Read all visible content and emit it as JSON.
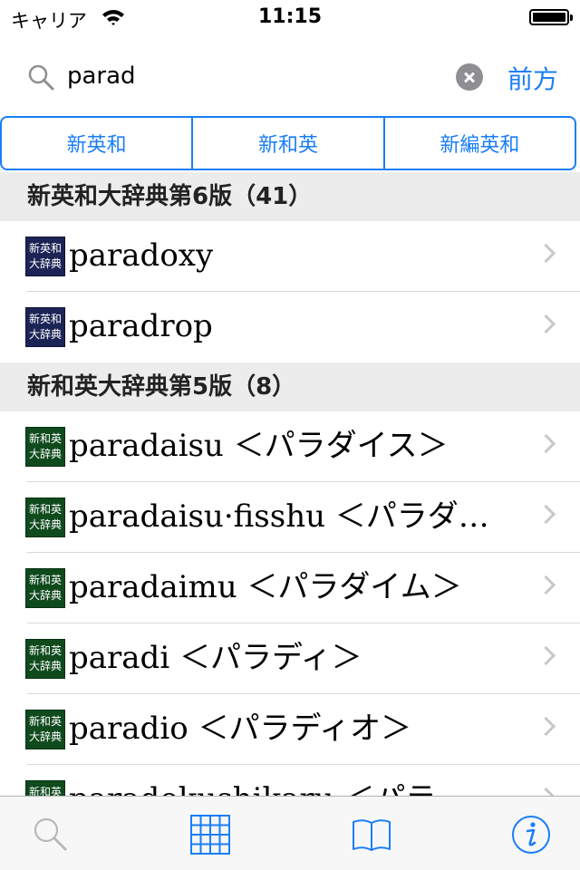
{
  "status_bar": {
    "carrier": "キャリア",
    "time": "11:15"
  },
  "search": {
    "query": "parad",
    "prefix_button": "前方"
  },
  "segments": [
    "新英和",
    "新和英",
    "新編英和"
  ],
  "colors": {
    "accent": "#1a7ef7",
    "section_bg": "#ececec"
  },
  "sections": [
    {
      "title": "新英和大辞典第6版（41）",
      "thumb_line1": "新英和",
      "thumb_line2": "大辞典",
      "rows": [
        "paradoxy",
        "paradrop"
      ]
    },
    {
      "title": "新和英大辞典第5版（8）",
      "thumb_line1": "新和英",
      "thumb_line2": "大辞典",
      "rows": [
        "paradaisu ＜パラダイス＞",
        "paradaisu·fisshu ＜パラダ…",
        "paradaimu ＜パラダイム＞",
        "paradi ＜パラディ＞",
        "paradio ＜パラディオ＞",
        "paradokushikaru ＜パラド…"
      ]
    }
  ],
  "tab_bar": [
    "search-icon",
    "grid-icon",
    "book-icon",
    "info-icon"
  ]
}
